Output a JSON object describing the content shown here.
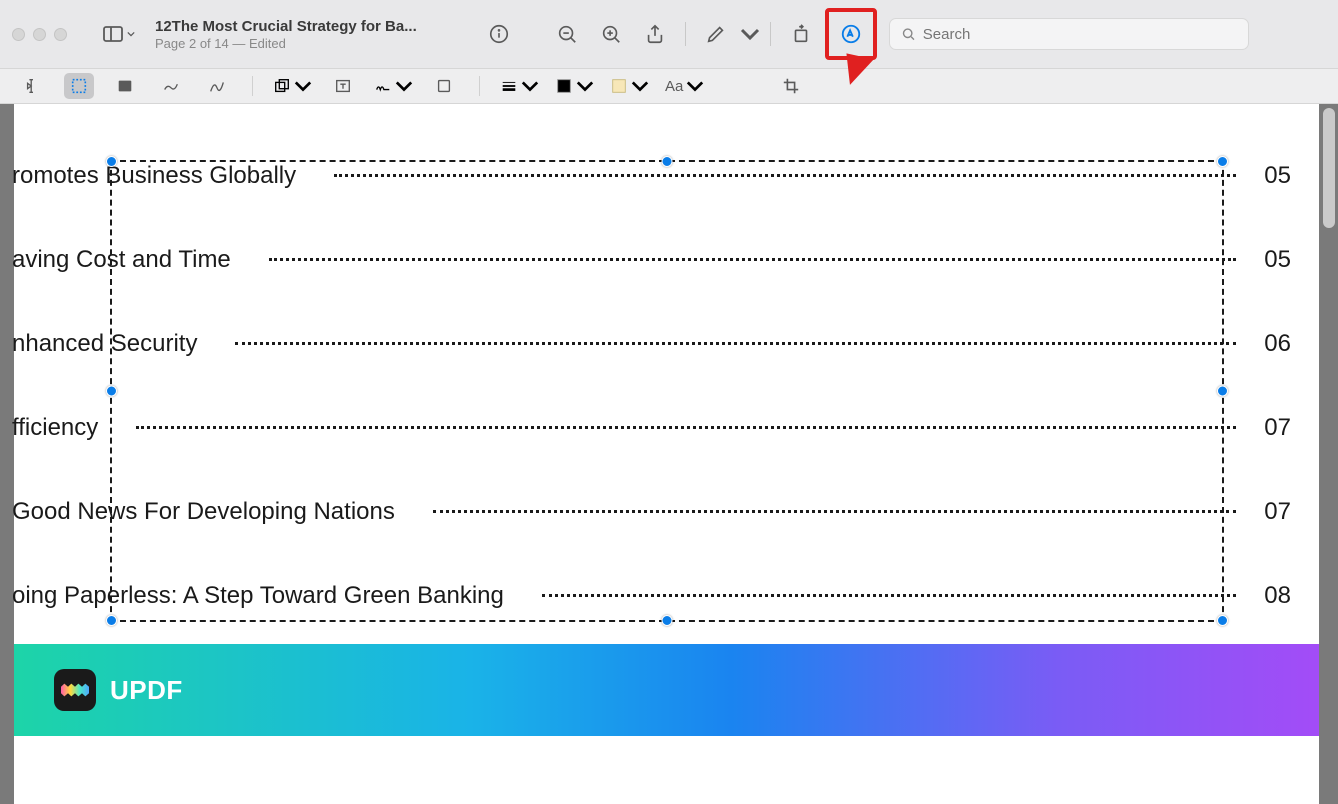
{
  "header": {
    "title": "12The Most Crucial Strategy for Ba...",
    "subtitle": "Page 2 of 14 — Edited"
  },
  "search": {
    "placeholder": "Search"
  },
  "toc": [
    {
      "title": "romotes Business Globally",
      "page": "05"
    },
    {
      "title": "aving Cost and Time",
      "page": "05"
    },
    {
      "title": "nhanced Security",
      "page": "06"
    },
    {
      "title": "fficiency",
      "page": "07"
    },
    {
      "title": " Good News For Developing Nations",
      "page": "07"
    },
    {
      "title": "oing Paperless: A Step Toward Green Banking",
      "page": "08"
    }
  ],
  "banner": {
    "label": "UPDF"
  },
  "colors": {
    "highlight": "#e02020",
    "handle": "#0a7de8"
  }
}
